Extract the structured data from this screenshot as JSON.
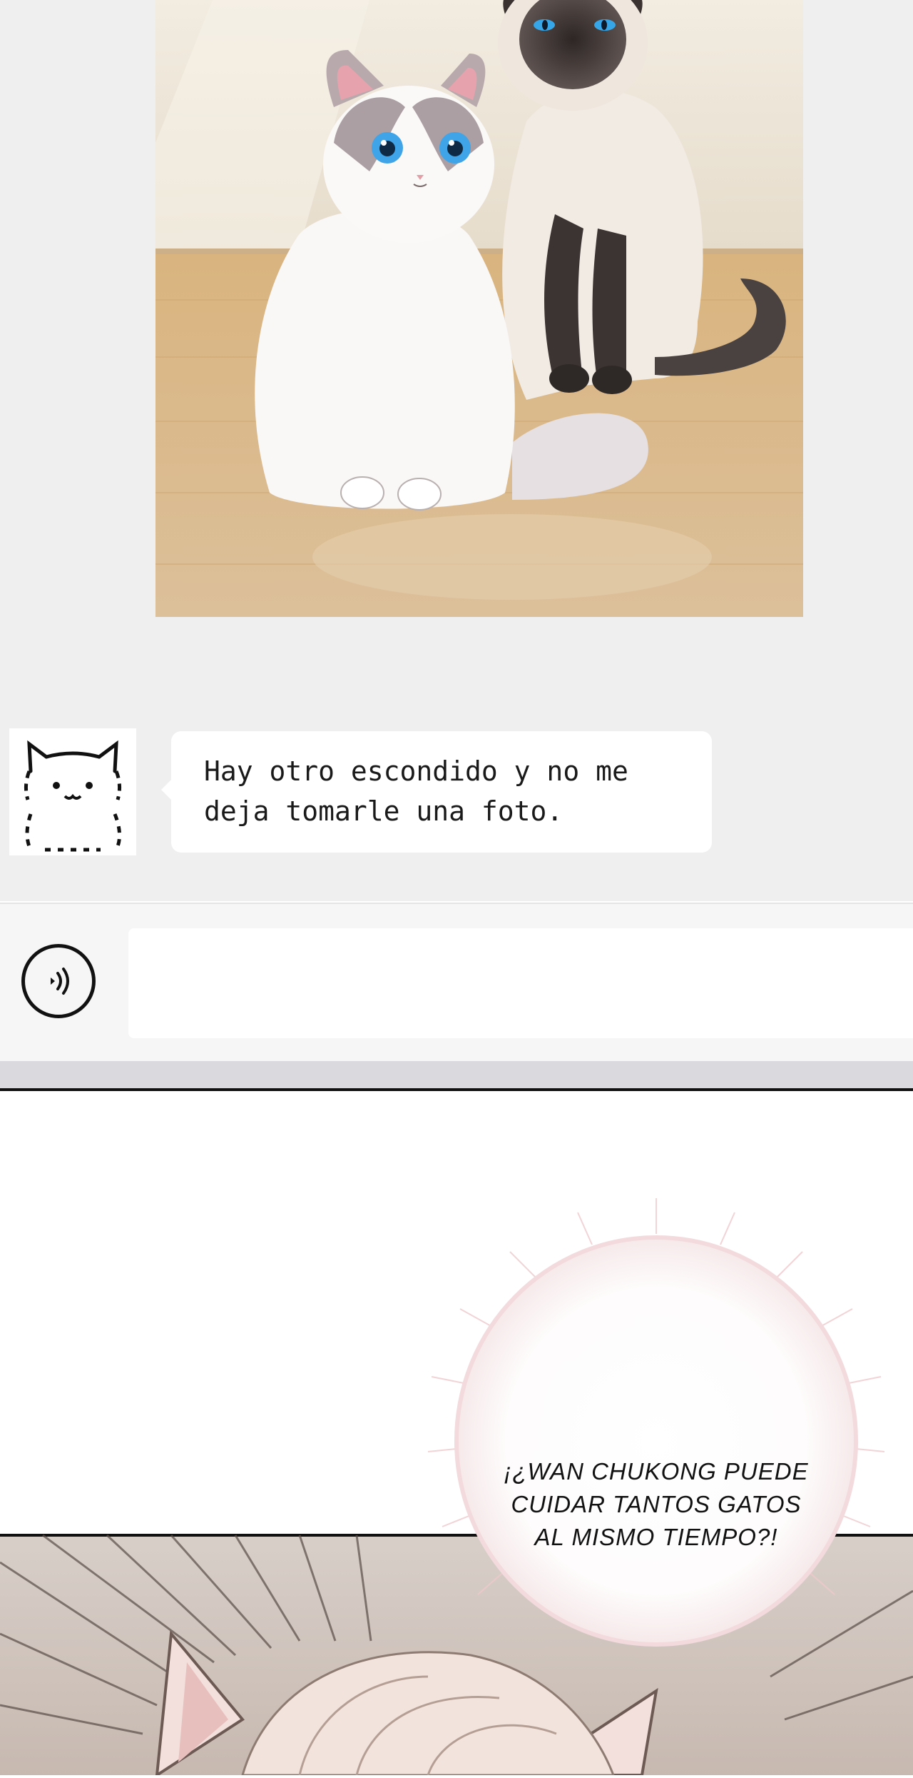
{
  "chat": {
    "received_message": {
      "text": "Hay otro escondido y no me\ndeja tomarle una foto."
    },
    "input": {
      "value": "",
      "placeholder": ""
    },
    "icons": {
      "voice": "voice-icon",
      "avatar": "fluffy-cat-avatar"
    }
  },
  "comic": {
    "speech": "¡¿WAN CHUKONG PUEDE\nCUIDAR TANTOS GATOS\nAL MISMO TIEMPO?!"
  },
  "colors": {
    "chat_background": "#efefef",
    "bubble": "#ffffff",
    "floor": "#d9b98e",
    "wall": "#efe8dc"
  }
}
